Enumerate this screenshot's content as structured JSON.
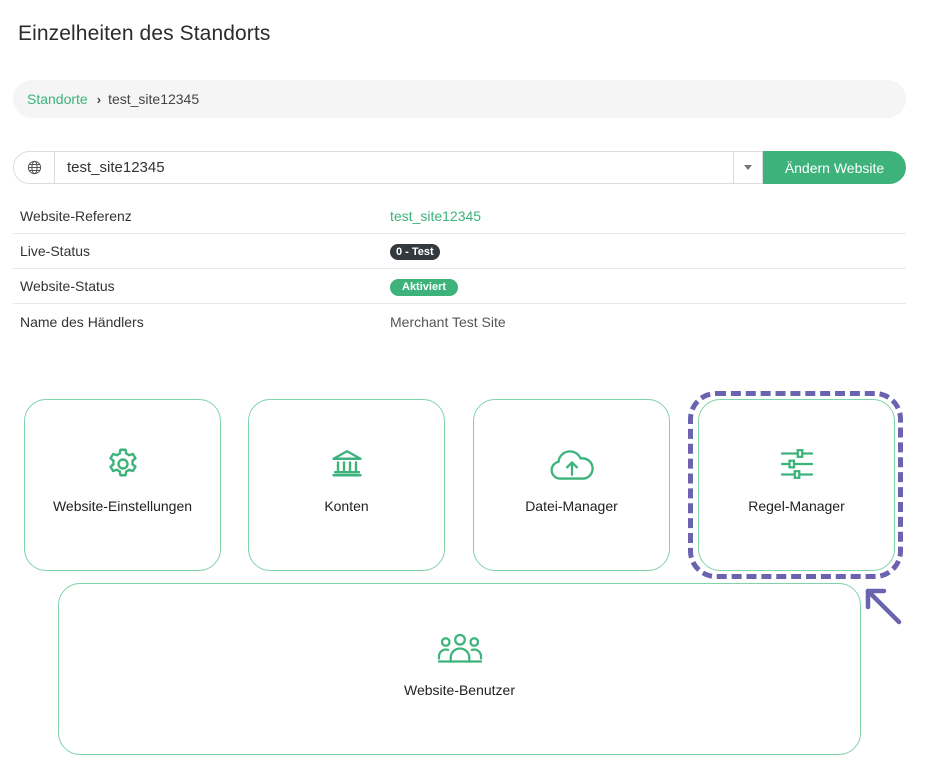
{
  "page": {
    "title": "Einzelheiten des Standorts"
  },
  "breadcrumb": {
    "parent": "Standorte",
    "current": "test_site12345"
  },
  "site_selector": {
    "value": "test_site12345",
    "button_label": "Ändern Website"
  },
  "details": {
    "rows": [
      {
        "label": "Website-Referenz",
        "value": "test_site12345"
      },
      {
        "label": "Live-Status",
        "value": "0 - Test"
      },
      {
        "label": "Website-Status",
        "value": "Aktiviert"
      },
      {
        "label": "Name des Händlers",
        "value": "Merchant Test Site"
      }
    ]
  },
  "tiles": [
    {
      "label": "Website-Einstellungen",
      "icon": "gear-icon"
    },
    {
      "label": "Konten",
      "icon": "bank-icon"
    },
    {
      "label": "Datei-Manager",
      "icon": "cloud-upload-icon"
    },
    {
      "label": "Regel-Manager",
      "icon": "sliders-icon"
    },
    {
      "label": "Website-Benutzer",
      "icon": "users-icon"
    }
  ],
  "colors": {
    "accent": "#3db37b",
    "tile_border": "#7fd3a8",
    "badge_dark": "#333a3f",
    "highlight": "#6a64b0"
  }
}
